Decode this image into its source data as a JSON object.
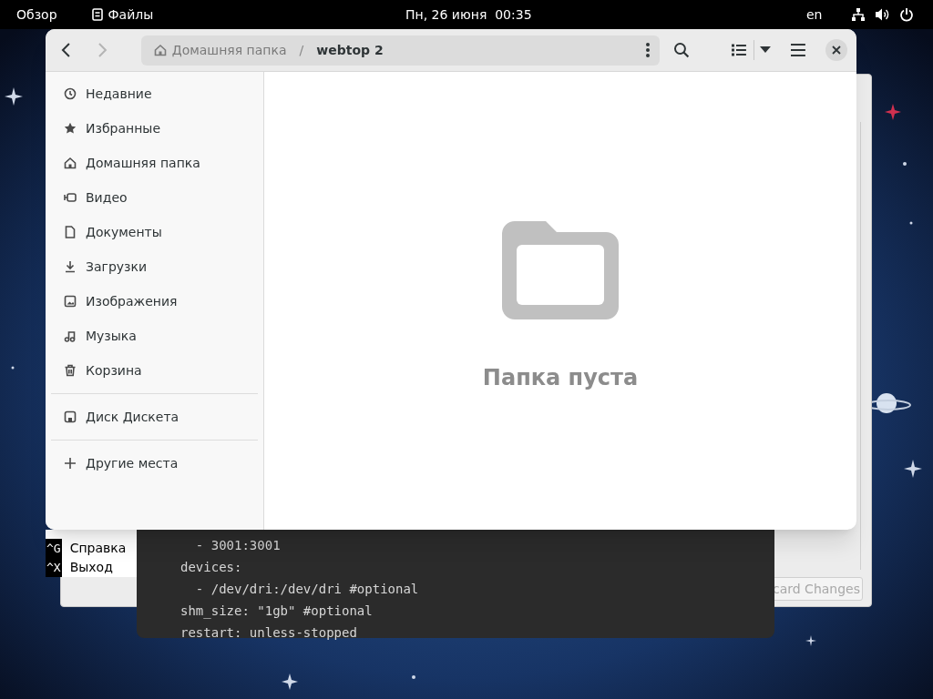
{
  "top_bar": {
    "overview": "Обзор",
    "app_menu": "Файлы",
    "clock": "Пн, 26 июня  00:35",
    "keyboard_layout": "en"
  },
  "files_window": {
    "path_separator": "/",
    "path": [
      {
        "label": "Домашняя папка",
        "selected": false
      },
      {
        "label": "webtop 2",
        "selected": true
      }
    ],
    "sidebar": {
      "sections": [
        [
          {
            "label": "Недавние"
          },
          {
            "label": "Избранные"
          },
          {
            "label": "Домашняя папка"
          },
          {
            "label": "Видео"
          },
          {
            "label": "Документы"
          },
          {
            "label": "Загрузки"
          },
          {
            "label": "Изображения"
          },
          {
            "label": "Музыка"
          },
          {
            "label": "Корзина"
          }
        ],
        [
          {
            "label": "Диск Дискета"
          }
        ],
        [
          {
            "label": "Другие места"
          }
        ]
      ]
    },
    "empty_message": "Папка пуста"
  },
  "nano_shortcuts": [
    {
      "key": "^G",
      "label": "Справка"
    },
    {
      "key": "^X",
      "label": "Выход"
    }
  ],
  "editor_lines": [
    "  - 3001:3001",
    "devices:",
    "  - /dev/dri:/dev/dri #optional",
    "shm_size: \"1gb\" #optional",
    "restart: unless-stopped"
  ],
  "back_window": {
    "button": "card Changes"
  }
}
